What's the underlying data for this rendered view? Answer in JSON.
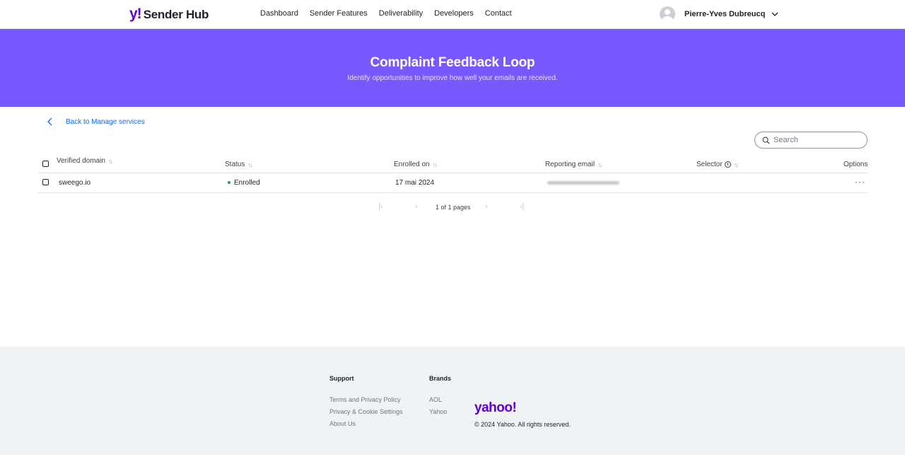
{
  "header": {
    "logo_mark": "y!",
    "logo_text": "Sender Hub",
    "nav": [
      "Dashboard",
      "Sender Features",
      "Deliverability",
      "Developers",
      "Contact"
    ],
    "user_name": "Pierre-Yves Dubreucq"
  },
  "banner": {
    "title": "Complaint Feedback Loop",
    "subtitle": "Identify opportunities to improve how well your emails are received."
  },
  "back_link": "Back to Manage services",
  "search": {
    "placeholder": "Search"
  },
  "table": {
    "columns": [
      "Verified domain",
      "Status",
      "Enrolled on",
      "Reporting email",
      "Selector",
      "Options"
    ],
    "rows": [
      {
        "domain": "sweego.io",
        "status": "Enrolled",
        "enrolled_on": "17 mai 2024",
        "options": "···"
      }
    ]
  },
  "pagination": {
    "text": "1 of 1 pages"
  },
  "footer": {
    "support_title": "Support",
    "support_links": [
      "Terms and Privacy Policy",
      "Privacy & Cookie Settings",
      "About Us"
    ],
    "brands_title": "Brands",
    "brands_links": [
      "AOL",
      "Yahoo"
    ],
    "yahoo_logo": "yahoo!",
    "copyright": "© 2024 Yahoo. All rights reserved."
  },
  "colors": {
    "banner": "#7759ff",
    "brand_purple": "#6001d2",
    "link_blue": "#0f69ff",
    "enrolled_green": "#1a9e55",
    "footer_bg": "#f0f3f5"
  },
  "icons": [
    "avatar-icon",
    "chevron-down-icon",
    "chevron-left-icon",
    "search-icon",
    "sort-icon",
    "info-icon",
    "more-icon",
    "first-page-icon",
    "prev-page-icon",
    "next-page-icon",
    "last-page-icon"
  ]
}
